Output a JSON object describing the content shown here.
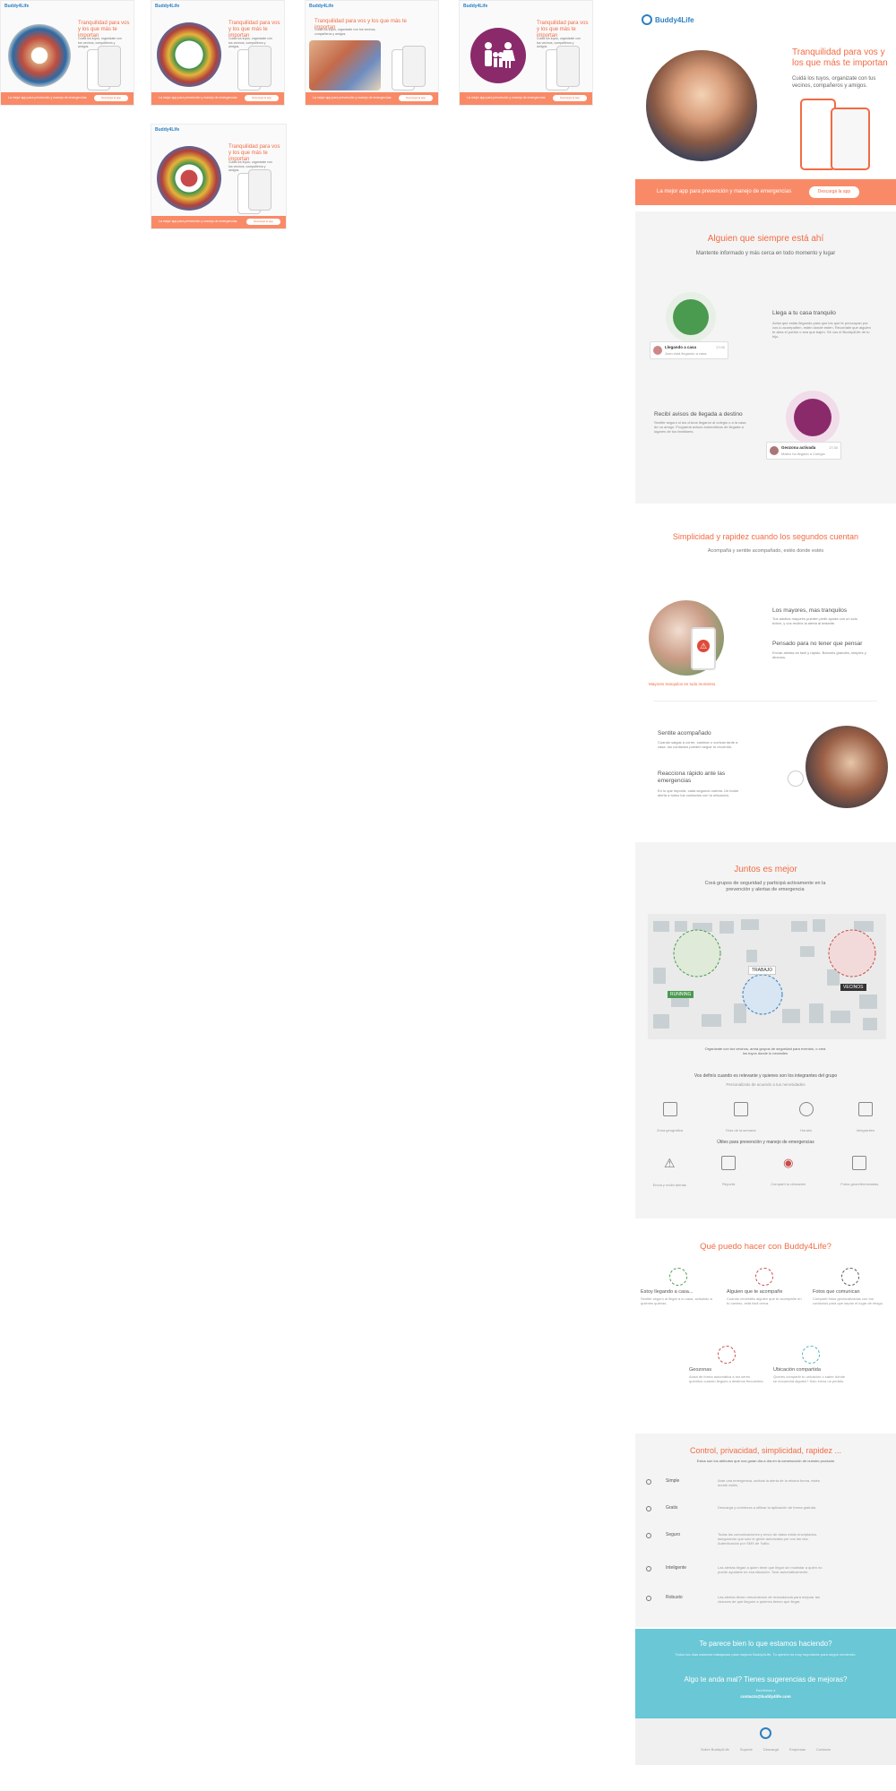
{
  "thumbnails": [
    {
      "logo": "Buddy4Life",
      "title": "Tranquilidad para vos y los que más te importan",
      "subtitle": "Cuidá los tuyos, organizate con tus vecinos, compañeros y amigos.",
      "cta_text": "La mejor app para prevención y manejo de emergencias",
      "cta_button": "Descargá la app"
    },
    {
      "logo": "Buddy4Life",
      "title": "Tranquilidad para vos y los que más te importan",
      "subtitle": "Cuidá los tuyos, organizate con tus vecinos, compañeros y amigos.",
      "cta_text": "La mejor app para prevención y manejo de emergencias",
      "cta_button": "Descargá la app"
    },
    {
      "logo": "Buddy4Life",
      "title": "Tranquilidad para vos y los que más te importan",
      "subtitle": "Cuidá los tuyos, organizate con tus vecinos, compañeros y amigos.",
      "cta_text": "La mejor app para prevención y manejo de emergencias",
      "cta_button": "Descargá la app"
    },
    {
      "logo": "Buddy4Life",
      "title": "Tranquilidad para vos y los que más te importan",
      "subtitle": "Cuidá los tuyos, organizate con tus vecinos, compañeros y amigos.",
      "cta_text": "La mejor app para prevención y manejo de emergencias",
      "cta_button": "Descargá la app"
    },
    {
      "logo": "Buddy4Life",
      "title": "Tranquilidad para vos y los que más te importan",
      "subtitle": "Cuidá los tuyos, organizate con tus vecinos, compañeros y amigos.",
      "cta_text": "La mejor app para prevención y manejo de emergencias",
      "cta_button": "Descargá la app"
    }
  ],
  "header": {
    "logo": "Buddy4Life"
  },
  "hero": {
    "title": "Tranquilidad para vos y los que más te importan",
    "subtitle": "Cuidá los tuyos, organizate con tus vecinos, compañeros y amigos."
  },
  "cta_band": {
    "text": "La mejor app para prevención y manejo de emergencias",
    "button": "Descargá la app"
  },
  "always": {
    "title": "Alguien que siempre está ahí",
    "subtitle": "Mantente informado y más cerca en todo momento y lugar",
    "f1_title": "Llega a tu casa tranquilo",
    "f1_text": "Avisá que estás llegando para que los que te preocupan por vos lo acompañen, estén donde estén. Recordale que alguien te abra el portón o sea que bajen. Sé vos el Buddy4Life de tu hijo.",
    "f1_card_title": "Llegando a casa",
    "f1_card_sub": "Juan está llegando a casa",
    "f1_card_time": "17:00",
    "f2_title": "Recibí avisos de llegada a destino",
    "f2_text": "Sentite seguro si tus chicos llegaron al colegio o a la casa de un amigo. Programá avisos automáticos de llegada a lugares de tus familiares.",
    "f2_card_title": "Geozona activada",
    "f2_card_sub": "Mateo ha llegado a Colegio",
    "f2_card_time": "17:30"
  },
  "simple": {
    "title": "Simplicidad y rapidez cuando los segundos cuentan",
    "subtitle": "Acompañá y sentite acompañado, estés donde estés",
    "f1_title": "Los mayores, mas tranquilos",
    "f1_text": "Tus adultos mayores pueden pedir ayuda con un solo botón, y vos recibís la alerta al instante.",
    "f2_title": "Pensado para no tener que pensar",
    "f2_text": "Enviar alertas es fácil y rápido. Botones grandes, simples y directos.",
    "caption": "Mayores tranquilos en todo momento",
    "f3_title": "Sentite acompañado",
    "f3_text": "Cuando salgas a correr, caminar o vuelvas tarde a casa, tus contactos pueden seguir tu recorrido.",
    "f4_title": "Reacciona rápido ante las emergencias",
    "f4_text": "En lo que importa, cada segundo cuenta. Un botón alerta a todos tus contactos con tu ubicación."
  },
  "together": {
    "title": "Juntos es mejor",
    "subtitle": "Creá grupos de seguridad y participá activamente en la prevención y alertas de emergencia",
    "map_labels": [
      "TRABAJO",
      "RUNNING",
      "VECINOS"
    ],
    "map_caption": "Organizate con tus vecinos, armá grupos de seguridad para eventos, o crea los tuyos donde lo necesites",
    "define_title": "Vos definís cuando es relevante y quienes son los integrantes del grupo",
    "define_sub": "Personalizalo de acuerdo a tus necesidades",
    "define_items": [
      "Zona geográfica",
      "Días de la semana",
      "Horario",
      "Integrantes"
    ],
    "tools_title": "Útiles para prevención y manejo de emergencias",
    "tools_items": [
      "Envía y recibí alertas",
      "Reportá",
      "Compartí tu ubicación",
      "Fotos georeferenciadas"
    ]
  },
  "what": {
    "title": "Qué puedo hacer con Buddy4Life?",
    "items": [
      {
        "title": "Estoy llegando a casa...",
        "text": "Sentite seguro al llegar a tu casa, avisando a quienes quieras."
      },
      {
        "title": "Alguien que te acompañe",
        "text": "Cuando necesites alguien que te acompañe en tu camino, está fácil cerca."
      },
      {
        "title": "Fotos que comunican",
        "text": "Compartí fotos geolocalizadas con tus contactos para que sepan el lugar de riesgo."
      },
      {
        "title": "Geozonas",
        "text": "Avisá de forma automática a tus seres queridos cuando llegues a destinos frecuentes."
      },
      {
        "title": "Ubicación compartida",
        "text": "Querés compartir tu ubicación o saber dónde se encuentra alguien? Solo envía un pedido."
      }
    ]
  },
  "control": {
    "title": "Control, privacidad, simplicidad, rapidez ...",
    "subtitle": "Estos son los atributos que nos guían día a día en la construcción de nuestro producto",
    "rows": [
      {
        "label": "Simple",
        "text": "Ante una emergencia, activás la alerta de la misma forma, estés donde estés."
      },
      {
        "label": "Gratis",
        "text": "Descarga y comienza a utilizar la aplicación de forma gratuita."
      },
      {
        "label": "Seguro",
        "text": "Todas las comunicaciones y envío de datos están encriptados, asegurando que solo le gente autorizada por vos las vea. Autenticación por SMS de Twilio."
      },
      {
        "label": "Inteligente",
        "text": "Las alertas llegan a quien tiene que llegar sin molestar a quien no puede ayudarte en esa situación. Todo automáticamente."
      },
      {
        "label": "Robusto",
        "text": "Las alertas tienen mecanismos de redundancia para mejorar las chances de que lleguen a quienes tienen que llegar."
      }
    ]
  },
  "blue": {
    "title1": "Te parece bien lo que estamos haciendo?",
    "text1": "Todos los días estamos trabajando para mejorar Buddy4Life. Tu opinión es muy importante para seguir creciendo.",
    "title2": "Algo te anda mal? Tienes sugerencias de mejoras?",
    "text2": "Escribinos a",
    "email": "contacto@buddy4life.com"
  },
  "footer": {
    "links": [
      "Sobre Buddy4Life",
      "Soporte",
      "Descargá",
      "Empresas",
      "Contacto"
    ]
  },
  "colors": {
    "accent": "#f26b43",
    "band": "#f98a68",
    "blue": "#6ac7d6",
    "gray": "#f4f4f4"
  }
}
